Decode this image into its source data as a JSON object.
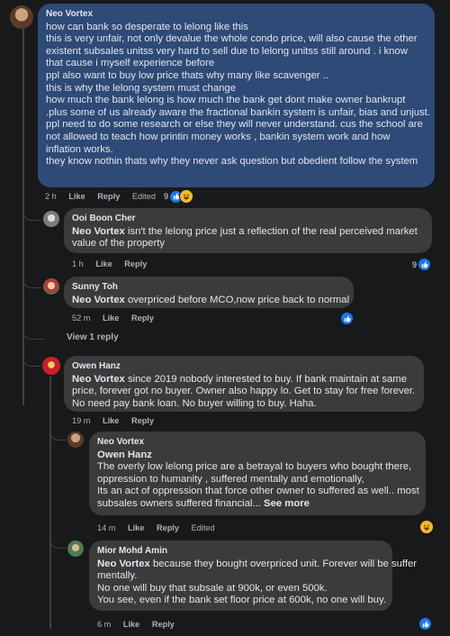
{
  "comments": [
    {
      "author": "Neo Vortex",
      "lines": [
        "how can bank so desperate to lelong like this",
        "this is very unfair, not only devalue the whole condo price, will also cause the other",
        "existent subsales unitss very hard to sell due to lelong unitss still around . i know",
        "that cause i myself experience before",
        "ppl also want to buy low price thats why many like scavenger ..",
        "this is why the lelong system must change",
        "how much the bank lelong is how much the bank get dont make owner bankrupt",
        ".plus some of us already aware the fractional bankin system is unfair, bias and unjust.",
        "ppl need to do some research or else they will never understand. cus the school are",
        "not allowed to teach how printin money works , bankin system work and how",
        "inflation works.",
        "they know nothin thats why they never ask question but obedient follow the system"
      ],
      "time": "2 h",
      "like": "Like",
      "reply": "Reply",
      "edited": "Edited",
      "reactions": "9"
    },
    {
      "author": "Ooi Boon Cher",
      "tag": "Neo Vortex",
      "lines": [
        "isn't the lelong price just a reflection of the real perceived market",
        "value of the property"
      ],
      "time": "1 h",
      "like": "Like",
      "reply": "Reply",
      "reactions": "9"
    },
    {
      "author": "Sunny Toh",
      "tag": "Neo Vortex",
      "lines": [
        "overpriced before MCO,now price back to normal"
      ],
      "time": "52 m",
      "like": "Like",
      "reply": "Reply"
    },
    {
      "author": "Owen Hanz",
      "tag": "Neo Vortex",
      "lines": [
        "since 2019 nobody interested to buy. If bank maintain at same",
        "price, forever got no buyer. Owner also happy lo. Get to stay for free forever.",
        "No need pay bank loan. No buyer willing to buy. Haha."
      ],
      "time": "19 m",
      "like": "Like",
      "reply": "Reply"
    },
    {
      "author": "Neo Vortex",
      "tag": "Owen Hanz",
      "lines": [
        "The overly low lelong price are a betrayal to buyers who bought there,",
        "oppression to humanity , suffered mentally and emotionally,",
        "Its an act of oppression that force other owner to suffered as well.. most",
        "subsales owners suffered financial..."
      ],
      "see_more": "See more",
      "time": "14 m",
      "like": "Like",
      "reply": "Reply",
      "edited": "Edited"
    },
    {
      "author": "Mior Mohd Amin",
      "tag": "Neo Vortex",
      "lines": [
        "because they bought overpriced unit. Forever will be suffer",
        "mentally.",
        "No one will buy that subsale at 900k, or even 500k.",
        "You see, even if the bank set floor price at 600k, no one will buy."
      ],
      "time": "6 m",
      "like": "Like",
      "reply": "Reply"
    }
  ],
  "view_reply": "View 1 reply",
  "colors": {
    "bg": "#18191a",
    "main_bubble": "#2e4a77",
    "reply_bubble": "#3a3b3c",
    "like": "#1877f2",
    "haha": "#f7b928"
  }
}
